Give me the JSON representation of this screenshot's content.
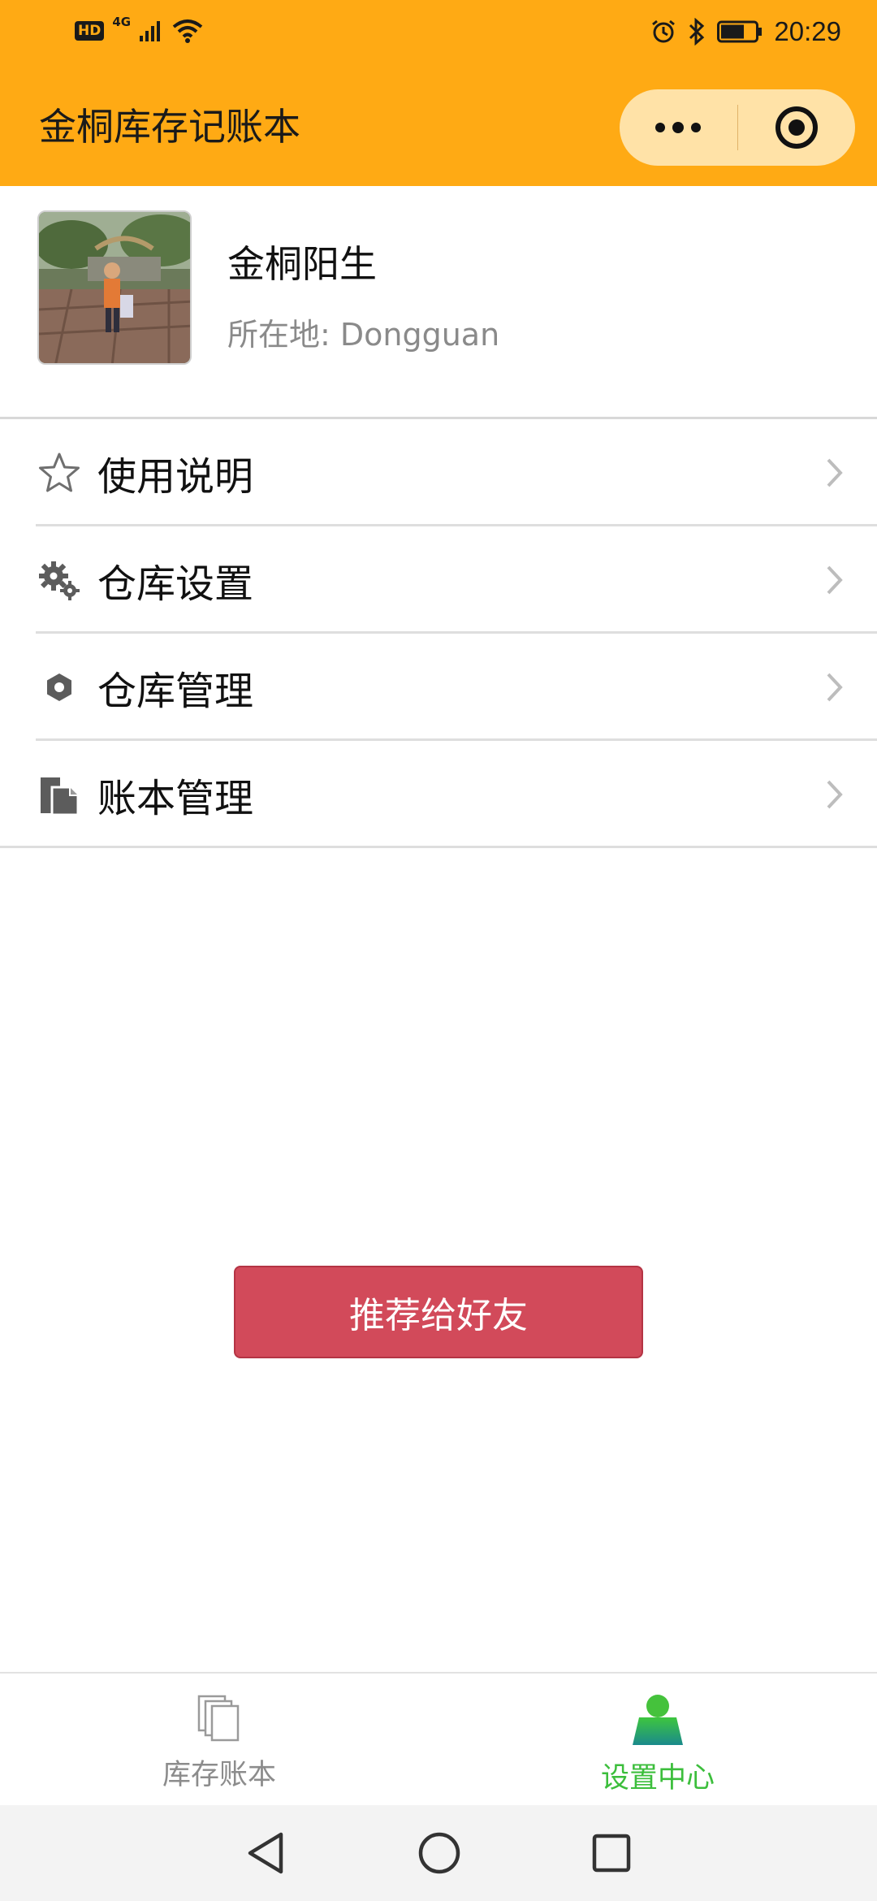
{
  "status_bar": {
    "hd": "HD",
    "network": "4G",
    "time": "20:29"
  },
  "header": {
    "title": "金桐库存记账本"
  },
  "profile": {
    "name": "金桐阳生",
    "location": "所在地: Dongguan"
  },
  "menu": {
    "items": [
      {
        "label": "使用说明",
        "icon": "star-icon"
      },
      {
        "label": "仓库设置",
        "icon": "gears-icon"
      },
      {
        "label": "仓库管理",
        "icon": "hexagon-icon"
      },
      {
        "label": "账本管理",
        "icon": "documents-icon"
      }
    ]
  },
  "recommend_button": {
    "label": "推荐给好友",
    "color": "#d24a5a"
  },
  "tabbar": {
    "tabs": [
      {
        "label": "库存账本",
        "active": false
      },
      {
        "label": "设置中心",
        "active": true
      }
    ]
  },
  "theme": {
    "header_color": "#ffaa14",
    "active_tab_color": "#3cbe3c"
  }
}
